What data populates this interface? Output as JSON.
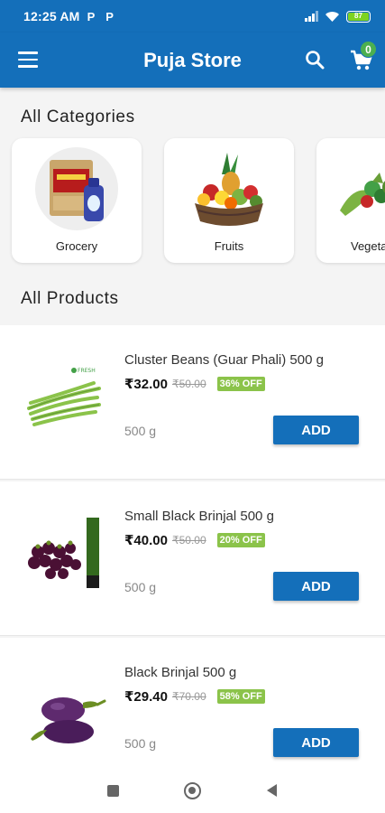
{
  "status_bar": {
    "time": "12:25 AM",
    "notif_1": "P",
    "notif_2": "P",
    "battery": "87"
  },
  "app_bar": {
    "title": "Puja Store",
    "cart_count": "0"
  },
  "categories_section": {
    "title": "All Categories"
  },
  "categories": [
    {
      "label": "Grocery",
      "icon": "grocery-pack"
    },
    {
      "label": "Fruits",
      "icon": "fruit-basket"
    },
    {
      "label": "Vegeta",
      "icon": "vegetables"
    }
  ],
  "products_section": {
    "title": "All Products"
  },
  "products": [
    {
      "name": "Cluster Beans (Guar Phali) 500 g",
      "price": "₹32.00",
      "mrp": "₹50.00",
      "discount": "36% OFF",
      "weight": "500 g",
      "add_label": "ADD"
    },
    {
      "name": "Small Black Brinjal 500 g",
      "price": "₹40.00",
      "mrp": "₹50.00",
      "discount": "20% OFF",
      "weight": "500 g",
      "add_label": "ADD"
    },
    {
      "name": "Black Brinjal 500 g",
      "price": "₹29.40",
      "mrp": "₹70.00",
      "discount": "58% OFF",
      "weight": "500 g",
      "add_label": "ADD"
    }
  ],
  "colors": {
    "primary": "#146fba",
    "discount_badge": "#8bc34a",
    "cart_badge": "#4caf50"
  }
}
